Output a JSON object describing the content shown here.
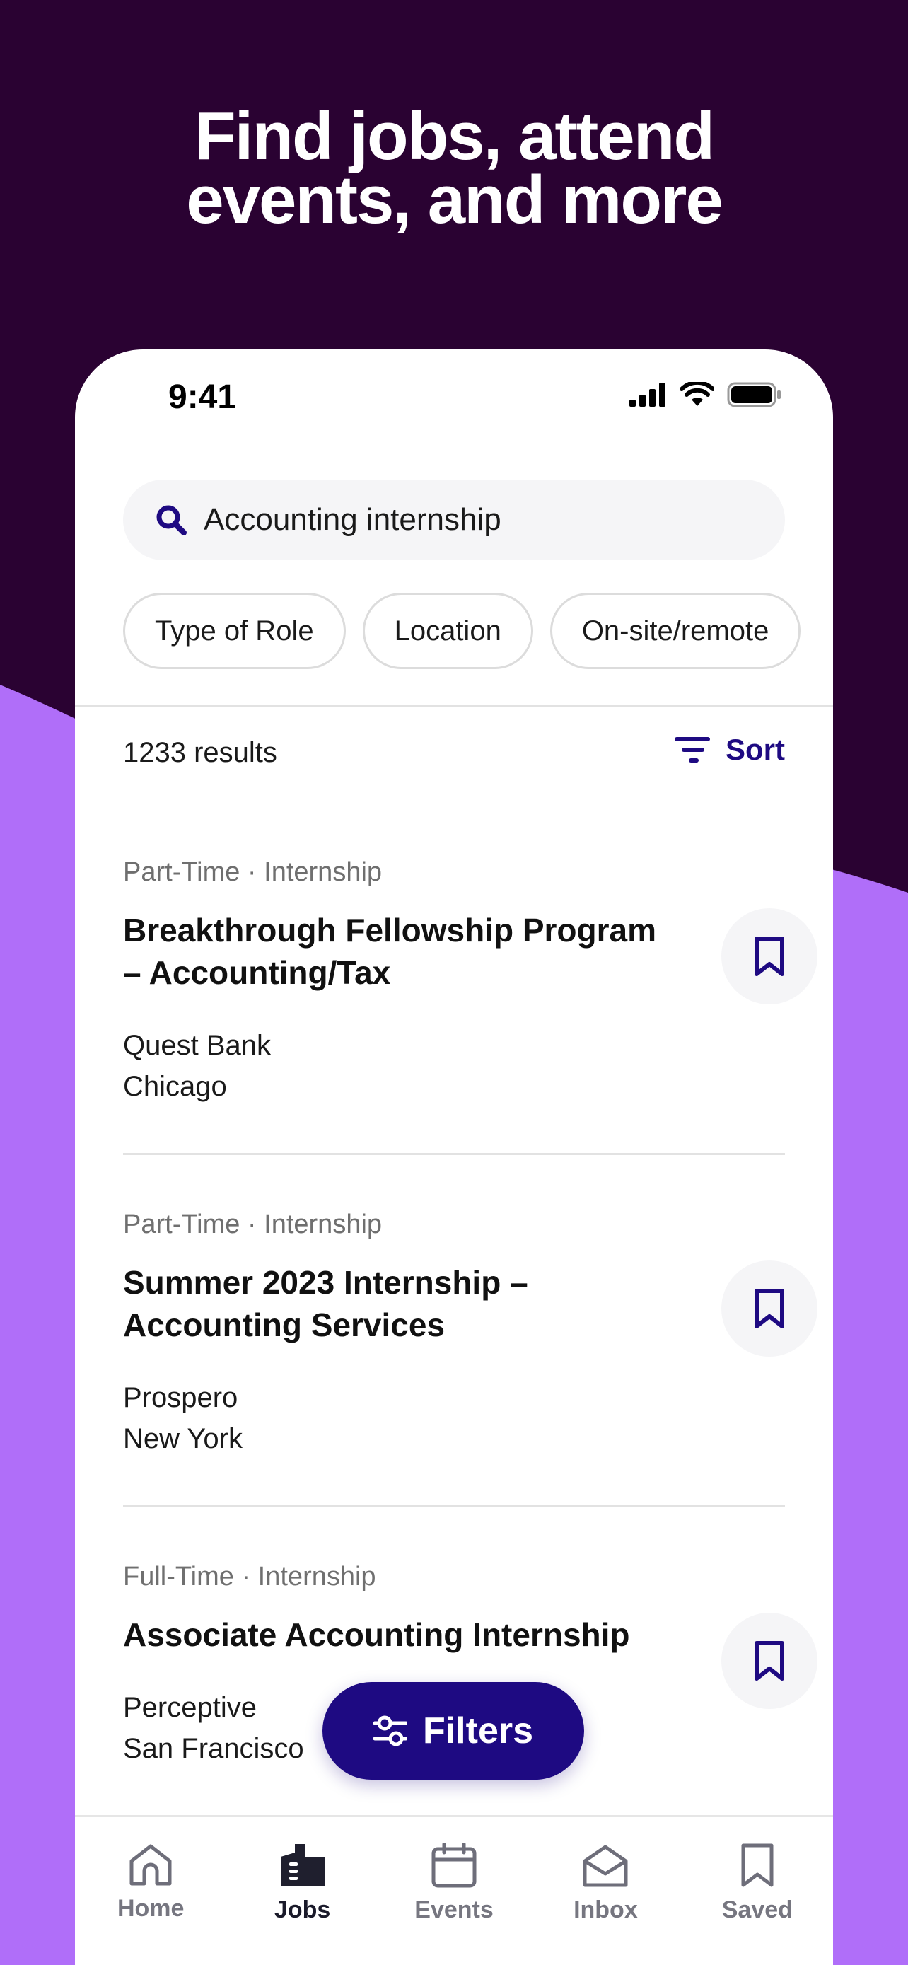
{
  "headline": {
    "line1": "Find jobs, attend",
    "line2": "events, and more"
  },
  "status_bar": {
    "time": "9:41"
  },
  "search": {
    "value": "Accounting internship"
  },
  "filter_chips": [
    {
      "label": "Type of Role"
    },
    {
      "label": "Location"
    },
    {
      "label": "On-site/remote"
    }
  ],
  "results": {
    "count": "1233 results",
    "sort_label": "Sort"
  },
  "jobs": [
    {
      "meta": "Part-Time · Internship",
      "title": "Breakthrough Fellowship Program – Accounting/Tax",
      "company": "Quest Bank",
      "city": "Chicago"
    },
    {
      "meta": "Part-Time · Internship",
      "title": "Summer 2023 Internship – Accounting Services",
      "company": "Prospero",
      "city": "New York"
    },
    {
      "meta": "Full-Time · Internship",
      "title": "Associate Accounting Internship",
      "company": "Perceptive",
      "city": "San Francisco"
    }
  ],
  "filters_button": {
    "label": "Filters"
  },
  "tab_bar": {
    "items": [
      {
        "label": "Home",
        "icon": "home-icon"
      },
      {
        "label": "Jobs",
        "icon": "jobs-building-icon"
      },
      {
        "label": "Events",
        "icon": "calendar-icon"
      },
      {
        "label": "Inbox",
        "icon": "inbox-envelope-icon"
      },
      {
        "label": "Saved",
        "icon": "bookmark-icon"
      }
    ],
    "active": "Jobs"
  },
  "colors": {
    "background_dark": "#2a0232",
    "background_wave": "#b06ef9",
    "accent": "#1e0a82",
    "surface": "#ffffff",
    "chip_border": "#dcdcdc",
    "muted_text": "#6f6f6f"
  }
}
